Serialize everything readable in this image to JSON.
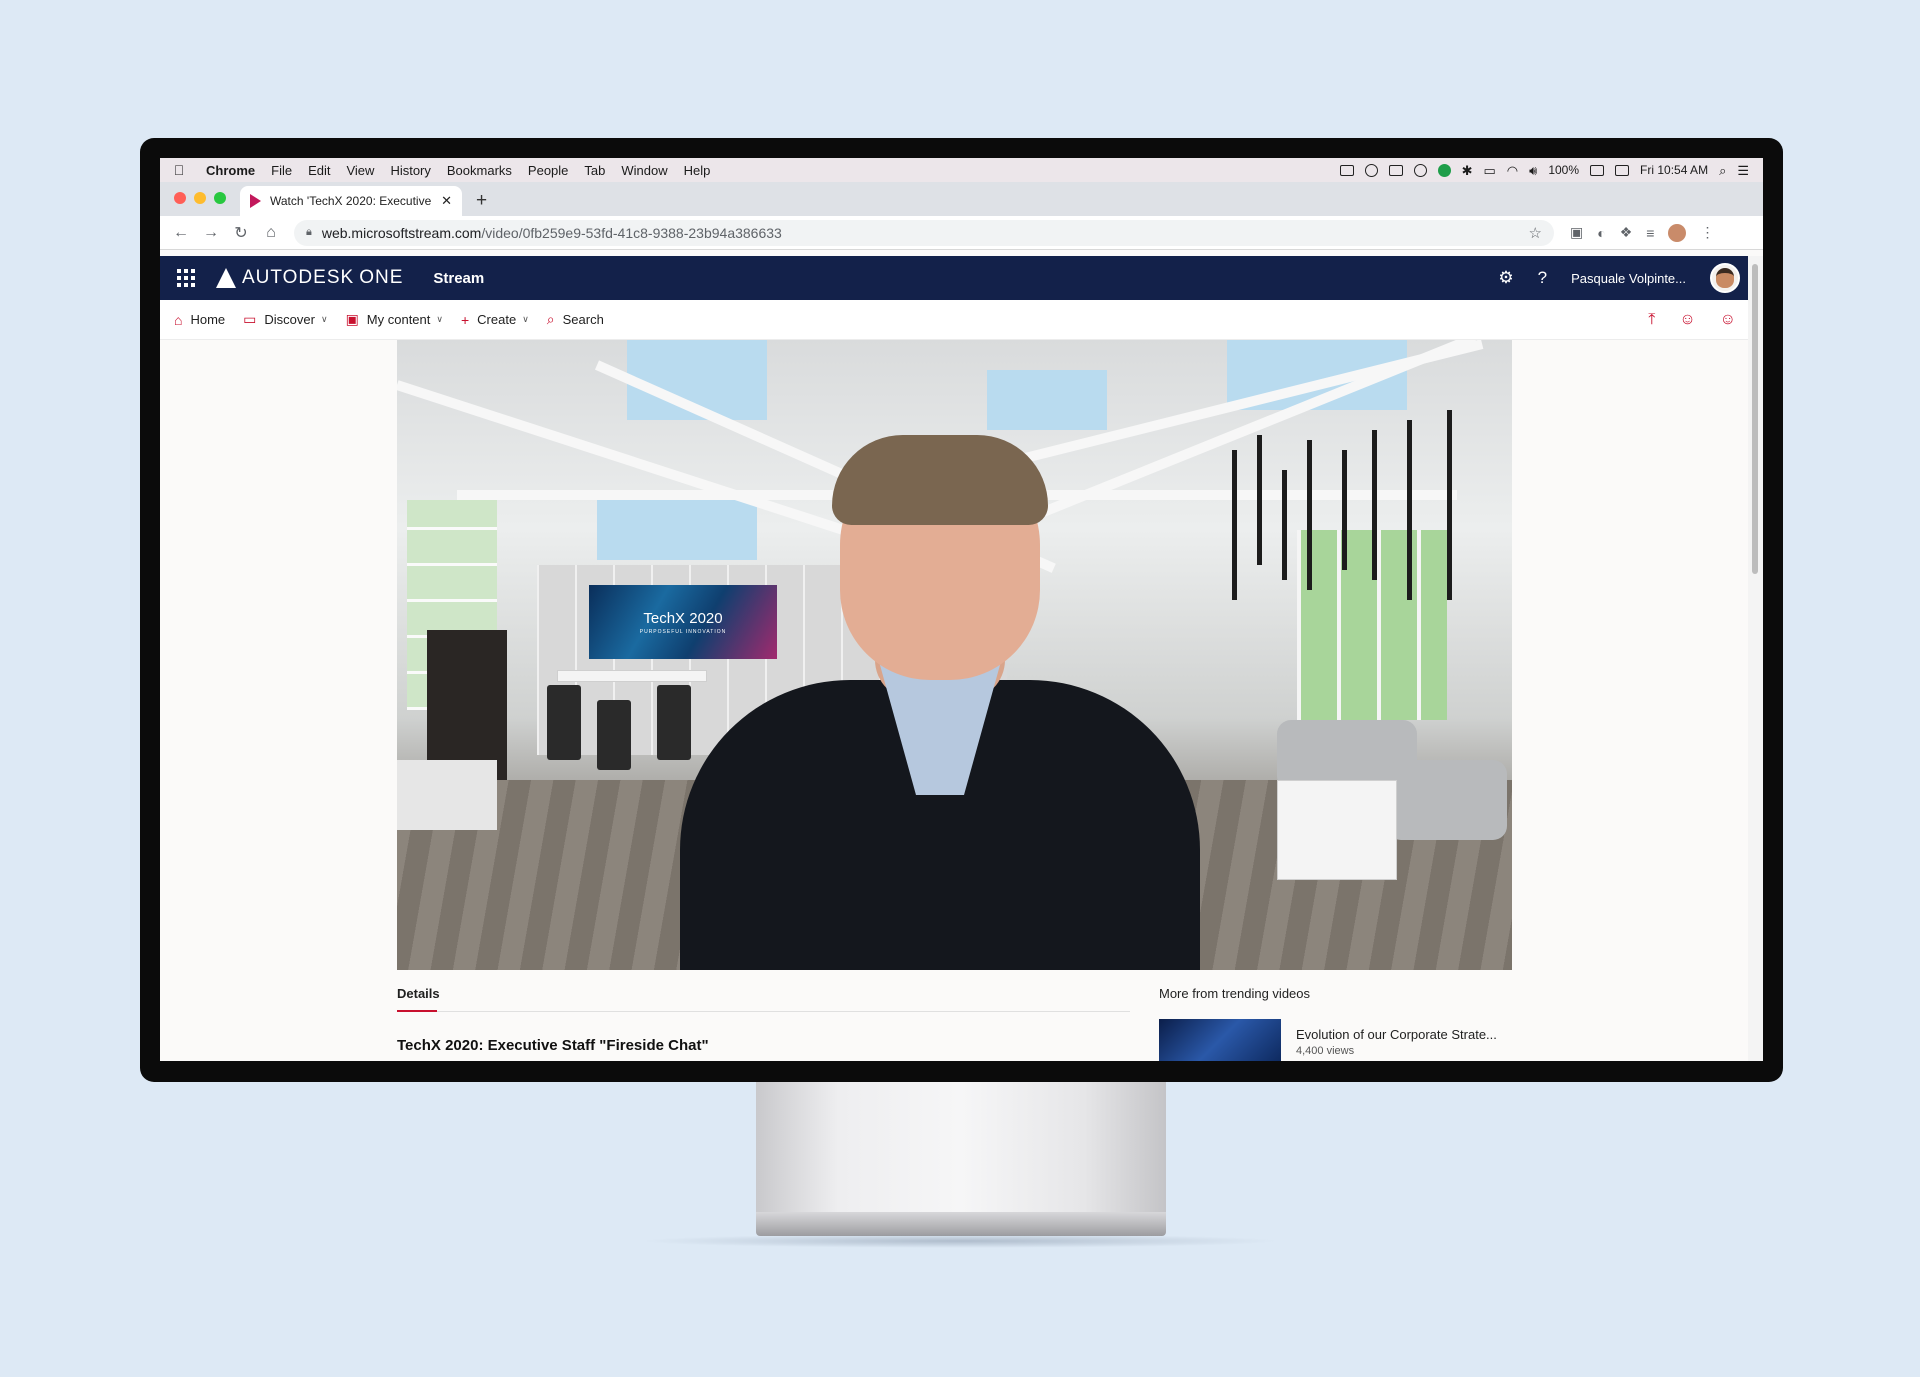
{
  "menubar": {
    "app": "Chrome",
    "items": [
      "File",
      "Edit",
      "View",
      "History",
      "Bookmarks",
      "People",
      "Tab",
      "Window",
      "Help"
    ],
    "battery": "100%",
    "clock": "Fri 10:54 AM"
  },
  "browser": {
    "tab_title": "Watch 'TechX 2020: Executive",
    "url_host": "web.microsoftstream.com",
    "url_path": "/video/0fb259e9-53fd-41c8-9388-23b94a386633"
  },
  "header": {
    "brand": "AUTODESK",
    "brand_suffix": "ONE",
    "app_name": "Stream",
    "user_name": "Pasquale Volpinte..."
  },
  "nav": {
    "home": "Home",
    "discover": "Discover",
    "my_content": "My content",
    "create": "Create",
    "search": "Search"
  },
  "video": {
    "banner_title": "TechX 2020",
    "banner_subtitle": "PURPOSEFUL INNOVATION"
  },
  "details": {
    "tab_label": "Details",
    "title": "TechX 2020: Executive Staff \"Fireside Chat\""
  },
  "trending": {
    "heading": "More from trending videos",
    "items": [
      {
        "title": "Evolution of our Corporate Strate...",
        "views": "4,400 views"
      }
    ]
  },
  "colors": {
    "header_bg": "#13214a",
    "accent": "#c8102e",
    "page_bg": "#dde9f5"
  }
}
